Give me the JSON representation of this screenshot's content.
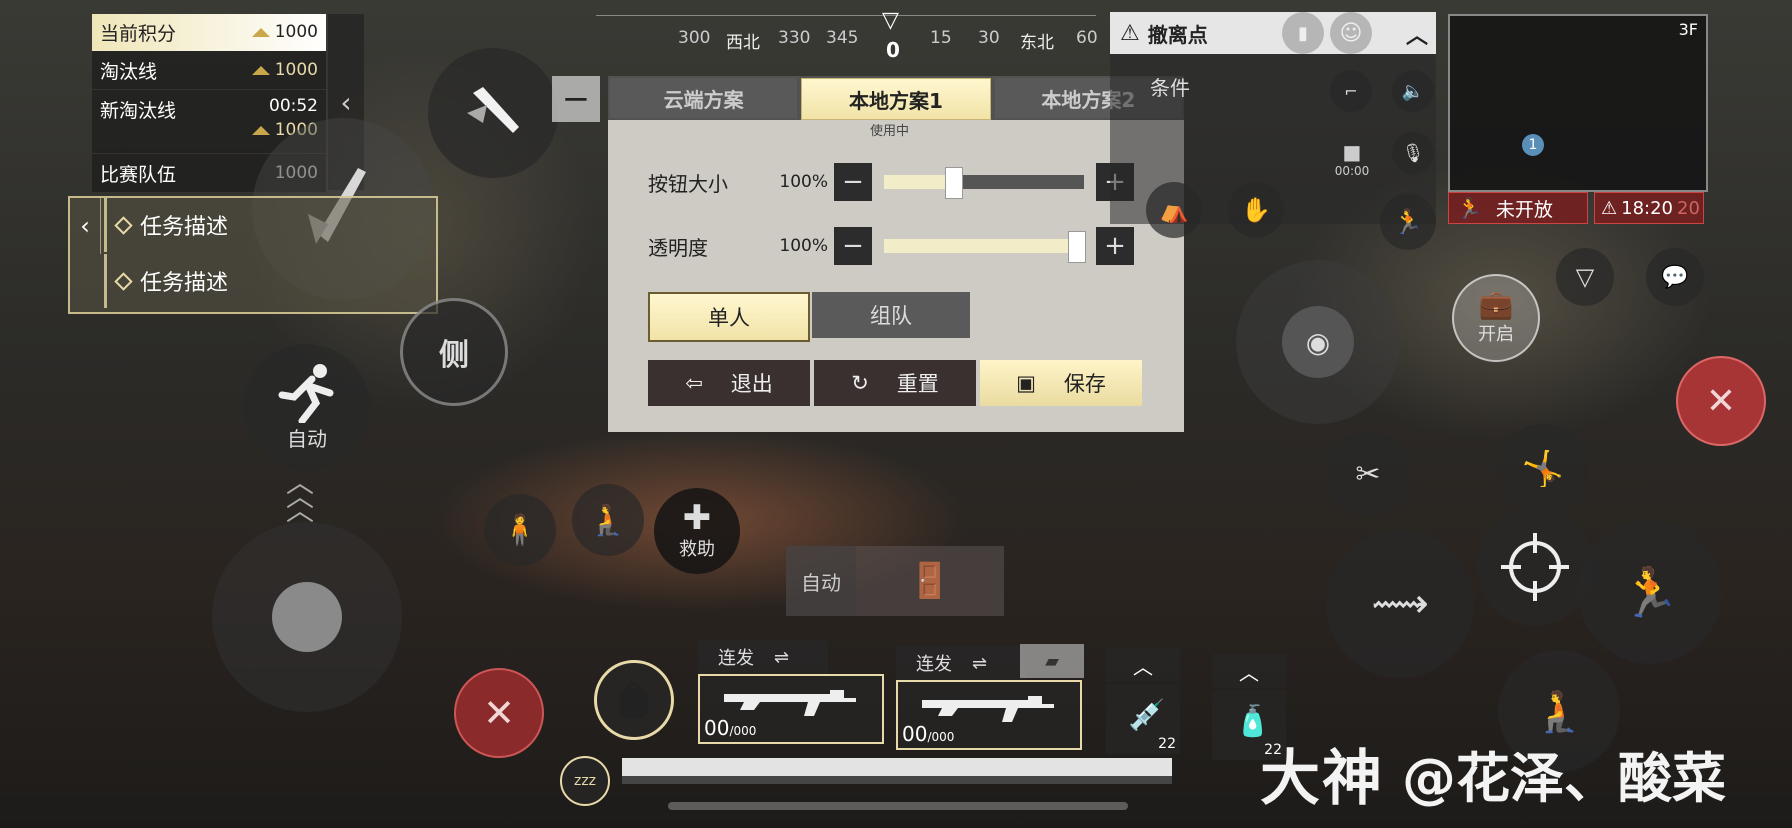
{
  "score_panel": {
    "rows": [
      {
        "label": "当前积分",
        "value": "1000"
      },
      {
        "label": "淘汰线",
        "value": "1000"
      },
      {
        "label": "新淘汰线",
        "time": "00:52",
        "value": "1000"
      },
      {
        "label": "比赛队伍",
        "value": "1000"
      }
    ]
  },
  "tasks": [
    "任务描述",
    "任务描述"
  ],
  "compass": {
    "ticks": [
      "300",
      "西北",
      "330",
      "345",
      "15",
      "30",
      "东北",
      "60"
    ],
    "heading": "0"
  },
  "dialog": {
    "tabs": [
      "云端方案",
      "本地方案1",
      "本地方案2"
    ],
    "active_tab": "本地方案1",
    "status": "使用中",
    "button_size": {
      "label": "按钮大小",
      "percent": "100%",
      "level": 0.33
    },
    "opacity": {
      "label": "透明度",
      "percent": "100%",
      "level": 1.0
    },
    "modes": [
      "单人",
      "组队"
    ],
    "active_mode": "单人",
    "actions": {
      "exit": "退出",
      "reset": "重置",
      "save": "保存"
    }
  },
  "evac": {
    "title": "撤离点",
    "condition": "条件",
    "voice_time": "00:00"
  },
  "minimap": {
    "floor": "3F",
    "marker": "1",
    "closed_label": "未开放",
    "timer": "18:20",
    "timer_ghost": "20"
  },
  "buttons": {
    "side": "侧",
    "auto_run": "自动",
    "rescue": "救助",
    "open": "开启",
    "door_auto": "自动"
  },
  "weapons": [
    {
      "mode": "连发",
      "ammo": "00",
      "reserve": "000"
    },
    {
      "mode": "连发",
      "ammo": "00",
      "reserve": "000"
    }
  ],
  "items": [
    {
      "count": "22"
    },
    {
      "count": "22"
    }
  ],
  "watermark": {
    "brand": "大神",
    "user": "@花泽、酸菜"
  },
  "colors": {
    "gold": "#e8d9a8",
    "danger": "#a52a2a",
    "panel": "#2c2c2c"
  }
}
